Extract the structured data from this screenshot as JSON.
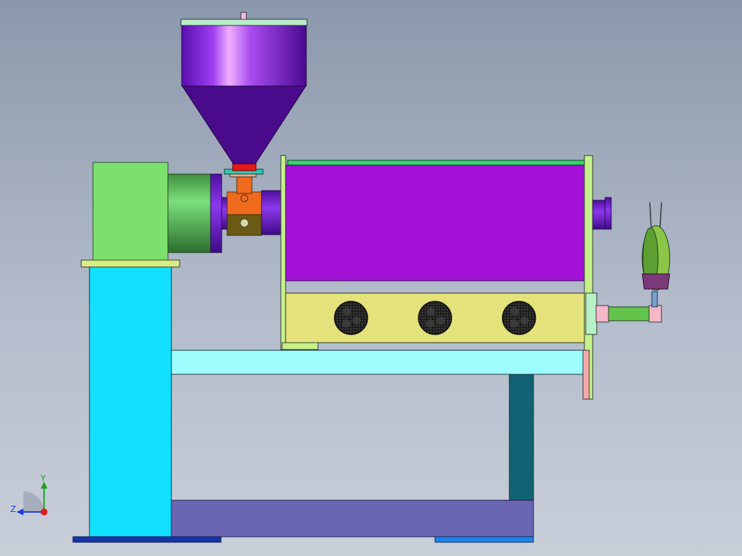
{
  "viewport": {
    "background_top": "#8b97ab",
    "background_bottom": "#c9cfd9"
  },
  "model": {
    "colors": {
      "hopper": "#7a22c8",
      "hopper_cone": "#4a0a8c",
      "motor_housing": "#7ddf6e",
      "coupling": "#48a848",
      "barrel_cover": "#a412d8",
      "heater_box": "#e4e27a",
      "fan": "#2a2a2a",
      "stand_column": "#12e0ff",
      "crossbeam": "#9efefe",
      "base_beam": "#6a66b4",
      "leg": "#116373",
      "feed_throat": "#f06a1e",
      "die_flange": "#f4a8a8",
      "foot_left": "#1634a6",
      "foot_right": "#1e84e8"
    }
  },
  "triad": {
    "y_label": "Y",
    "z_label": "Z",
    "y_color": "#1aa31a",
    "z_color": "#1a3be0",
    "origin_color": "#e01a1a"
  }
}
